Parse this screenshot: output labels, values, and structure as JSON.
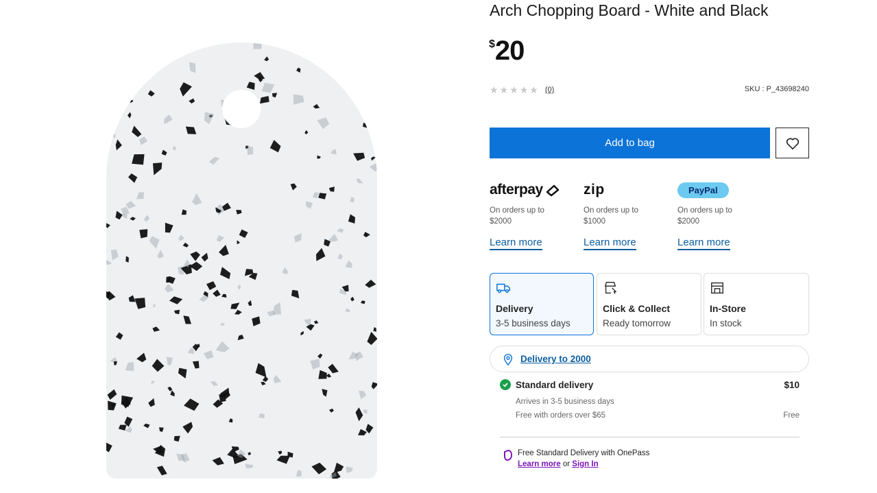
{
  "product": {
    "title": "Arch Chopping Board - White and Black",
    "currency_symbol": "$",
    "price": "20",
    "rating_stars": 0,
    "rating_count": "(0)",
    "sku": "SKU : P_43698240",
    "image_icon": "arch-chopping-board-image"
  },
  "actions": {
    "add_to_bag": "Add to bag",
    "wishlist_icon": "heart-icon"
  },
  "payments": [
    {
      "logo": "afterpay",
      "line1": "On orders up to",
      "line2": "$2000",
      "link": "Learn more"
    },
    {
      "logo": "zip",
      "line1": "On orders up to",
      "line2": "$1000",
      "link": "Learn more"
    },
    {
      "logo": "PayPal",
      "line1": "On orders up to",
      "line2": "$2000",
      "link": "Learn more"
    }
  ],
  "fulfilment": [
    {
      "icon": "truck-icon",
      "title": "Delivery",
      "subtitle": "3-5 business days",
      "selected": true
    },
    {
      "icon": "click-collect-icon",
      "title": "Click & Collect",
      "subtitle": "Ready tomorrow",
      "selected": false
    },
    {
      "icon": "store-icon",
      "title": "In-Store",
      "subtitle": "In stock",
      "selected": false
    }
  ],
  "delivery_location": {
    "icon": "location-pin-icon",
    "label": "Delivery to 2000"
  },
  "standard_delivery": {
    "title": "Standard delivery",
    "price": "$10",
    "arrives": "Arrives in 3-5 business days",
    "free_note": "Free with orders over $65",
    "free_label": "Free"
  },
  "onepass": {
    "text": "Free Standard Delivery with OnePass",
    "learn_more": "Learn more",
    "or": "or",
    "sign_in": "Sign In"
  },
  "colors": {
    "primary_button": "#0c73d8",
    "link": "#0c5ea0",
    "success": "#19a04b",
    "onepass": "#7a16b8",
    "paypal_badge": "#6ccaf0"
  }
}
